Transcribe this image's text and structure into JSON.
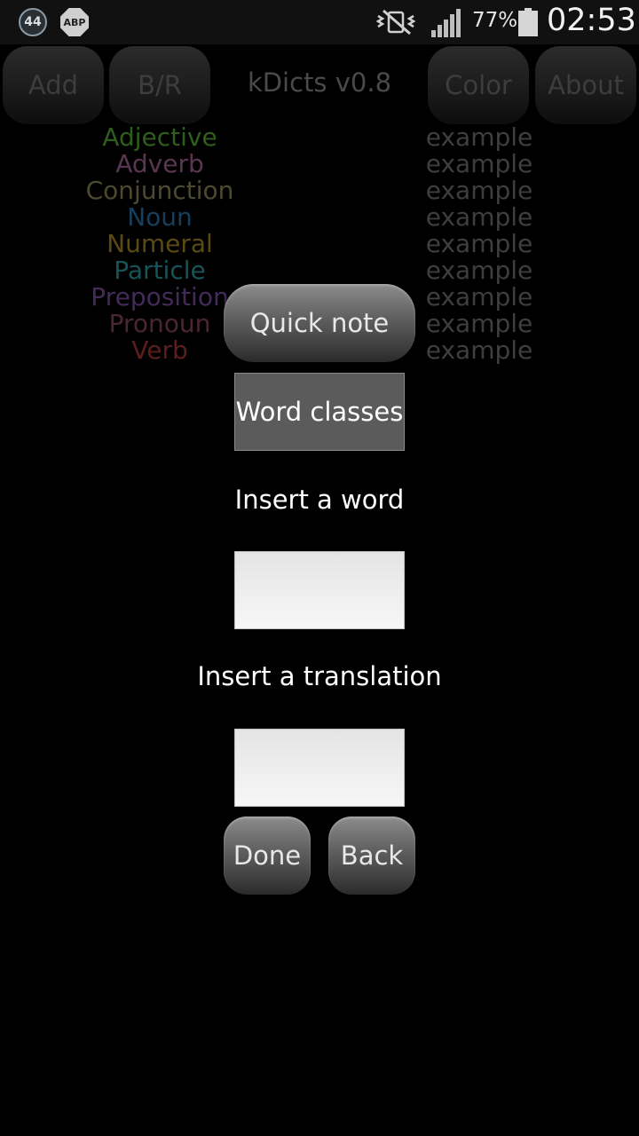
{
  "status_bar": {
    "notification_count": "44",
    "adblock_label": "ABP",
    "battery_percent": "77%",
    "clock": "02:53",
    "icons": [
      "notification-badge-icon",
      "adblock-plus-icon",
      "vibrate-mute-icon",
      "signal-strength-icon",
      "battery-icon"
    ]
  },
  "toolbar": {
    "add_label": "Add",
    "br_label": "B/R",
    "title": "kDicts v0.8",
    "color_label": "Color",
    "about_label": "About"
  },
  "word_classes": [
    {
      "label": "Adjective",
      "example": "example",
      "color": "#2f5e1c"
    },
    {
      "label": "Adverb",
      "example": "example",
      "color": "#5b3652"
    },
    {
      "label": "Conjunction",
      "example": "example",
      "color": "#4c4a2e"
    },
    {
      "label": "Noun",
      "example": "example",
      "color": "#173e5a"
    },
    {
      "label": "Numeral",
      "example": "example",
      "color": "#5c4a14"
    },
    {
      "label": "Particle",
      "example": "example",
      "color": "#175458"
    },
    {
      "label": "Preposition",
      "example": "example",
      "color": "#432a58"
    },
    {
      "label": "Pronoun",
      "example": "example",
      "color": "#4a2630"
    },
    {
      "label": "Verb",
      "example": "example",
      "color": "#5e1d1d"
    }
  ],
  "dialog": {
    "quick_note_label": "Quick note",
    "word_classes_label": "Word classes",
    "word_prompt": "Insert a word",
    "word_value": "",
    "translation_prompt": "Insert a translation",
    "translation_value": "",
    "done_label": "Done",
    "back_label": "Back"
  },
  "colors": {
    "background": "#000000",
    "example_text": "#3e3e3e",
    "dimmed_button_text": "#3d3d3d"
  }
}
